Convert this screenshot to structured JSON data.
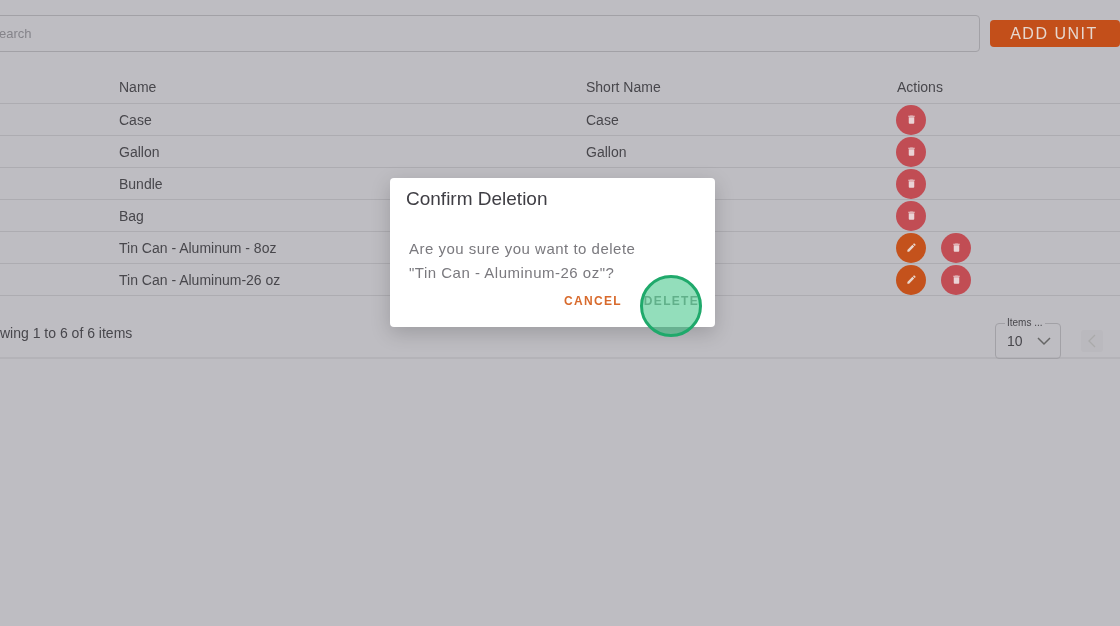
{
  "search": {
    "placeholder": "earch"
  },
  "add_button": "ADD UNIT",
  "table": {
    "columns": [
      "Name",
      "Short Name",
      "Actions"
    ],
    "rows": [
      {
        "name": "Case",
        "short_name": "Case",
        "actions": [
          {
            "kind": "delete"
          }
        ]
      },
      {
        "name": "Gallon",
        "short_name": "Gallon",
        "actions": [
          {
            "kind": "delete"
          }
        ]
      },
      {
        "name": "Bundle",
        "actions": [
          {
            "kind": "delete"
          }
        ]
      },
      {
        "name": "Bag",
        "actions": [
          {
            "kind": "delete"
          }
        ]
      },
      {
        "name": "Tin Can - Aluminum - 8oz",
        "actions": [
          {
            "kind": "edit"
          },
          {
            "kind": "delete"
          }
        ]
      },
      {
        "name": "Tin Can - Aluminum-26 oz",
        "actions": [
          {
            "kind": "edit"
          },
          {
            "kind": "delete"
          }
        ]
      }
    ]
  },
  "footer": {
    "summary": "wing 1 to 6 of 6 items",
    "page_size_label": "Items ...",
    "page_size": "10"
  },
  "dialog": {
    "title": "Confirm Deletion",
    "message": "Are you sure you want to delete \"Tin Can - Aluminum-26 oz\"?",
    "buttons": [
      {
        "label": "CANCEL",
        "kind": "cancel"
      },
      {
        "label": "DELETE",
        "kind": "confirm"
      }
    ]
  }
}
